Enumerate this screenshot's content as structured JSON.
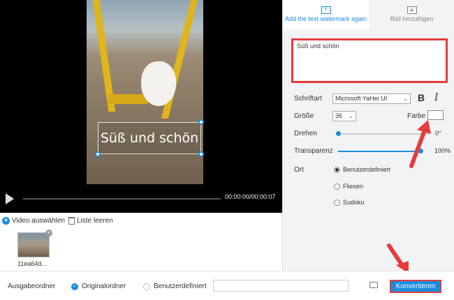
{
  "player": {
    "watermark_text": "Süß und schön",
    "time": "00:00:00/00:00:07",
    "progress_fraction": 0
  },
  "file_toolbar": {
    "add_video_label": "Video auswählen",
    "clear_list_label": "Liste leeren",
    "add_icon": "plus-circle-icon",
    "clear_icon": "trash-icon"
  },
  "thumbnail": {
    "label": "11ea64d..."
  },
  "tabs": [
    {
      "label": "Add the text watermark again",
      "icon": "text-watermark-icon",
      "active": true
    },
    {
      "label": "Bild hinzufügen",
      "icon": "image-icon",
      "active": false
    }
  ],
  "watermark_text_input": "Süß und schön",
  "settings": {
    "font_label": "Schriftart",
    "font_value": "Microsoft YaHei UI",
    "bold_label": "B",
    "italic_label": "I",
    "size_label": "Größe",
    "size_value": "36",
    "color_label": "Farbe",
    "color_value": "#ffffff",
    "rotate_label": "Drehen",
    "rotate_value": "0°",
    "rotate_fraction": 0,
    "opacity_label": "Transparenz",
    "opacity_value": "100%",
    "opacity_fraction": 1,
    "position_label": "Ort",
    "position_options": [
      "Benutzerdefiniert",
      "Fliesen",
      "Sudoku"
    ],
    "position_selected": "Benutzerdefiniert"
  },
  "bottom_bar": {
    "output_label": "Ausgabeordner",
    "original_folder_label": "Originalordner",
    "custom_folder_label": "Benutzerdefiniert",
    "path_value": "",
    "convert_label": "Konvertieren"
  },
  "colors": {
    "accent": "#1a8cde",
    "highlight": "#e63b3b"
  }
}
